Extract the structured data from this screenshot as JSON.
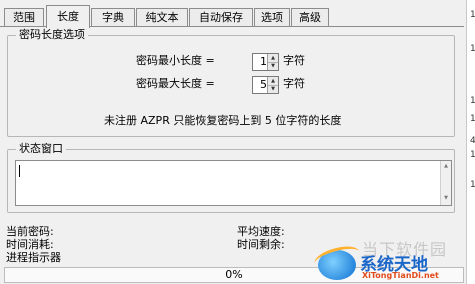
{
  "tabs": [
    {
      "label": "范围",
      "active": false
    },
    {
      "label": "长度",
      "active": true
    },
    {
      "label": "字典",
      "active": false
    },
    {
      "label": "纯文本",
      "active": false
    },
    {
      "label": "自动保存",
      "active": false
    },
    {
      "label": "选项",
      "active": false
    },
    {
      "label": "高级",
      "active": false
    }
  ],
  "length_options": {
    "title": "密码长度选项",
    "min_label": "密码最小长度 =",
    "min_value": "1",
    "max_label": "密码最大长度 =",
    "max_value": "5",
    "unit": "字符",
    "note": "未注册 AZPR 只能恢复密码上到 5 位字符的长度"
  },
  "status_window": {
    "title": "状态窗口",
    "content": ""
  },
  "info": {
    "current_password_label": "当前密码:",
    "avg_speed_label": "平均速度:",
    "time_elapsed_label": "时间消耗:",
    "time_remaining_label": "时间剩余:",
    "progress_label": "进程指示器"
  },
  "progress": {
    "text": "0%",
    "value": 0,
    "color": "#3fa14a"
  },
  "right_edge_digits": [
    "1",
    "1",
    "1",
    "1",
    "4",
    "1",
    "1"
  ],
  "watermark": {
    "top_text": "当下软件园",
    "main_text": "系统天地",
    "sub_text": "XiTongTianDi.net"
  }
}
